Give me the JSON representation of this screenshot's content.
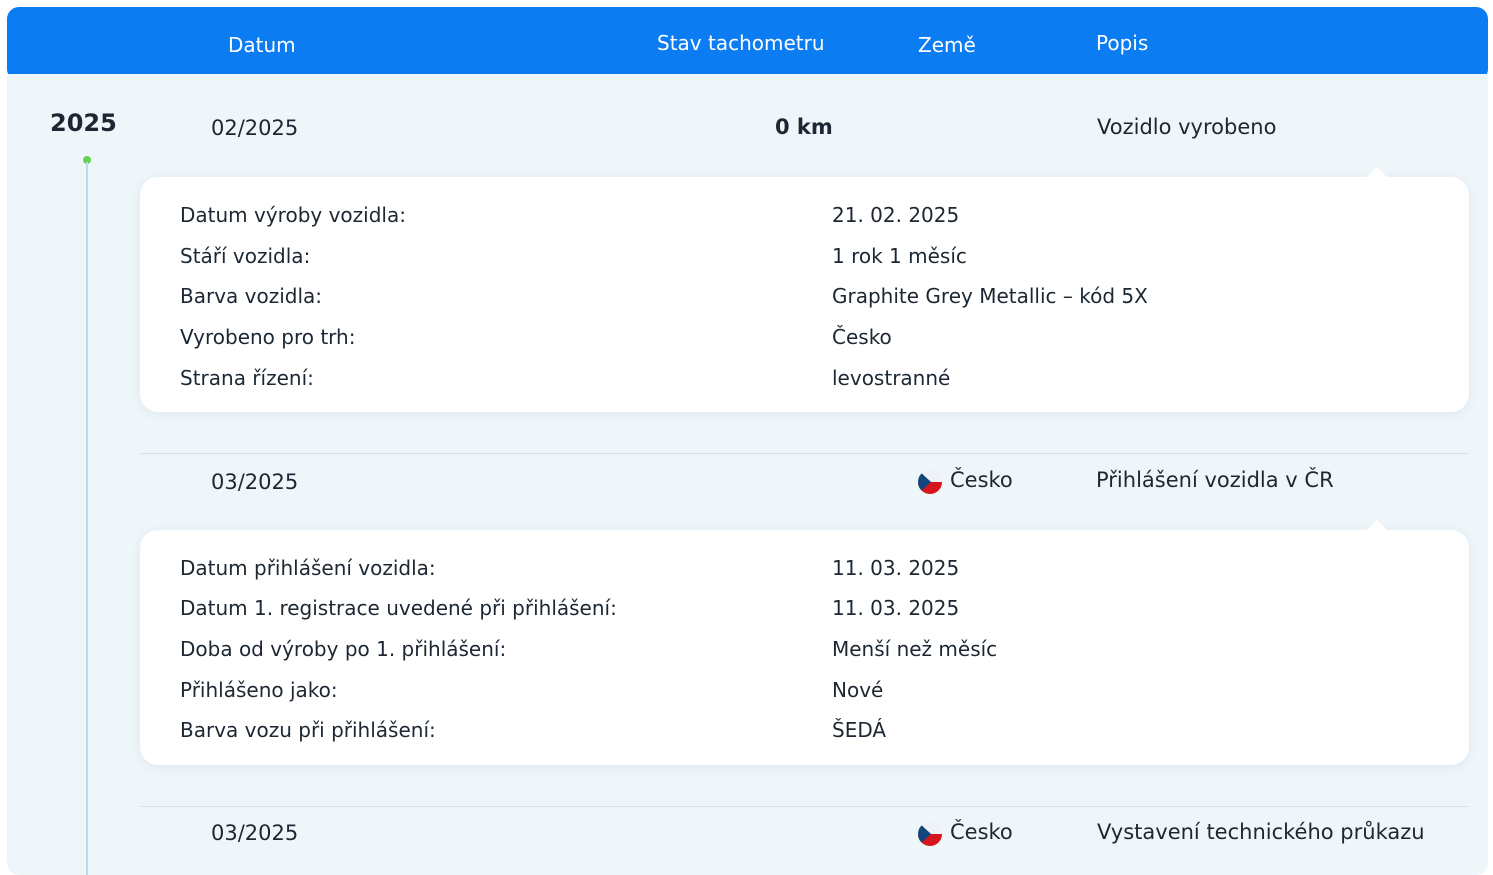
{
  "header": {
    "col_date": "Datum",
    "col_odometer": "Stav tachometru",
    "col_country": "Země",
    "col_description": "Popis"
  },
  "timeline": {
    "year": "2025",
    "events": [
      {
        "date": "02/2025",
        "odometer": "0 km",
        "country": "",
        "description": "Vozidlo vyrobeno",
        "details": [
          {
            "label": "Datum výroby vozidla:",
            "value": "21. 02. 2025"
          },
          {
            "label": "Stáří vozidla:",
            "value": "1 rok 1 měsíc"
          },
          {
            "label": "Barva vozidla:",
            "value": "Graphite Grey Metallic – kód 5X"
          },
          {
            "label": "Vyrobeno pro trh:",
            "value": "Česko"
          },
          {
            "label": "Strana řízení:",
            "value": "levostranné"
          }
        ]
      },
      {
        "date": "03/2025",
        "odometer": "",
        "country": "Česko",
        "flag_icon": "czech-flag-icon",
        "description": "Přihlášení vozidla v ČR",
        "details": [
          {
            "label": "Datum přihlášení vozidla:",
            "value": "11. 03. 2025"
          },
          {
            "label": "Datum 1. registrace uvedené při přihlášení:",
            "value": "11. 03. 2025"
          },
          {
            "label": "Doba od výroby po 1. přihlášení:",
            "value": "Menší než měsíc"
          },
          {
            "label": "Přihlášeno jako:",
            "value": "Nové"
          },
          {
            "label": "Barva vozu při přihlášení:",
            "value": "ŠEDÁ"
          }
        ]
      },
      {
        "date": "03/2025",
        "odometer": "",
        "country": "Česko",
        "flag_icon": "czech-flag-icon",
        "description": "Vystavení technického průkazu"
      }
    ]
  },
  "colors": {
    "header_bg": "#0c7cf2",
    "panel_bg": "#eff6fa",
    "timeline_dot": "#63d24f"
  }
}
